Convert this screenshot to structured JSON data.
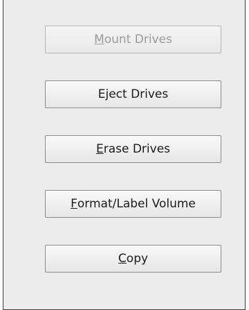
{
  "buttons": [
    {
      "mnemonic": "M",
      "rest": "ount Drives",
      "enabled": false
    },
    {
      "mnemonic": "",
      "rest": "Eject Drives",
      "enabled": true
    },
    {
      "mnemonic": "E",
      "rest": "rase Drives",
      "enabled": true
    },
    {
      "mnemonic": "F",
      "rest": "ormat/Label Volume",
      "enabled": true
    },
    {
      "mnemonic": "C",
      "rest": "opy",
      "enabled": true
    }
  ]
}
